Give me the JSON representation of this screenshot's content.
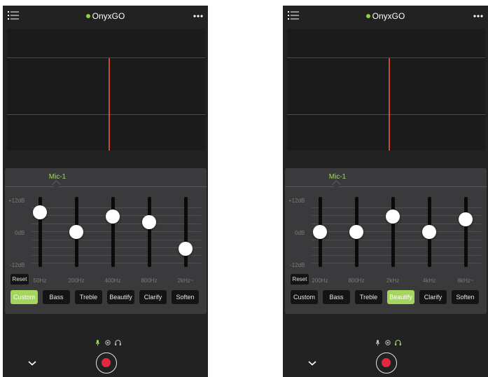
{
  "colors": {
    "accent_green": "#a4d65e",
    "status_dot": "#8bd23f",
    "playhead": "#d24a2b",
    "record": "#e5283d"
  },
  "screens": [
    {
      "title": "OnyxGO",
      "tab": "Mic-1",
      "db_labels": {
        "top": "+12dB",
        "mid": "0dB",
        "bottom": "-12dB"
      },
      "reset_label": "Reset",
      "bands": [
        {
          "freq": "50Hz",
          "level": 0.78
        },
        {
          "freq": "200Hz",
          "level": 0.5
        },
        {
          "freq": "400Hz",
          "level": 0.72
        },
        {
          "freq": "800Hz",
          "level": 0.64
        },
        {
          "freq": "2kHz~",
          "level": 0.26
        }
      ],
      "presets": [
        "Custom",
        "Bass",
        "Treble",
        "Beautify",
        "Clarify",
        "Soften"
      ],
      "active_preset": "Custom",
      "bottom_icons": [
        "mic-icon",
        "camera-icon",
        "headphone-icon"
      ],
      "active_bottom_icon": "mic-icon"
    },
    {
      "title": "OnyxGO",
      "tab": "Mic-1",
      "db_labels": {
        "top": "+12dB",
        "mid": "0dB",
        "bottom": "-12dB"
      },
      "reset_label": "Reset",
      "bands": [
        {
          "freq": "200Hz",
          "level": 0.5
        },
        {
          "freq": "800Hz",
          "level": 0.5
        },
        {
          "freq": "2kHz",
          "level": 0.72
        },
        {
          "freq": "4kHz",
          "level": 0.5
        },
        {
          "freq": "8kHz~",
          "level": 0.68
        }
      ],
      "presets": [
        "Custom",
        "Bass",
        "Treble",
        "Beautify",
        "Clarify",
        "Soften"
      ],
      "active_preset": "Beautify",
      "bottom_icons": [
        "mic-icon",
        "camera-icon",
        "headphone-icon"
      ],
      "active_bottom_icon": "headphone-icon"
    }
  ]
}
